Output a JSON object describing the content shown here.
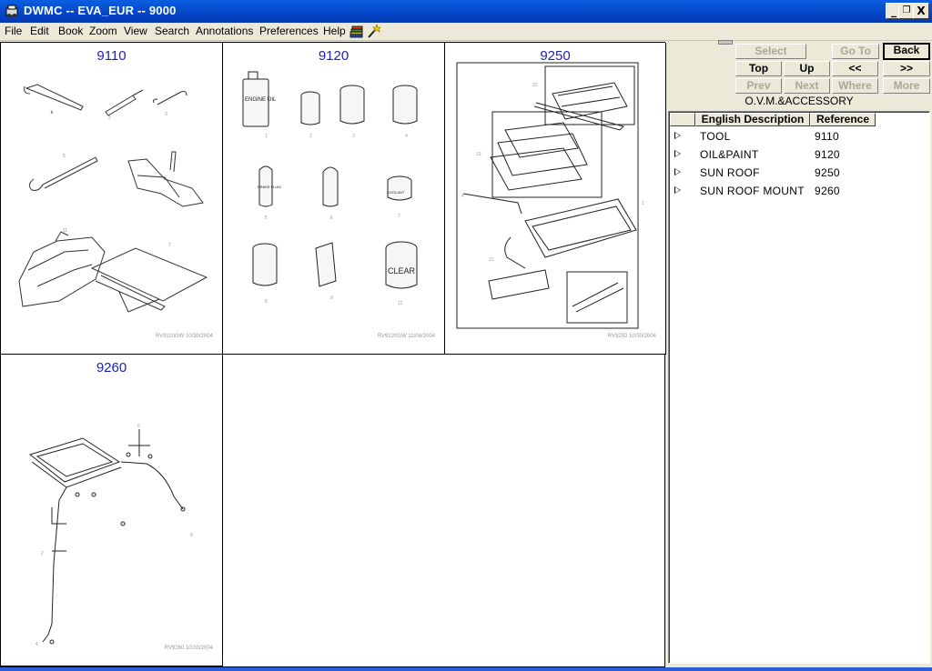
{
  "window": {
    "title": "DWMC -- EVA_EUR -- 9000",
    "minimize_label": "_",
    "restore_label": "❐",
    "close_label": "X"
  },
  "menu": [
    {
      "label": "File"
    },
    {
      "label": "Edit"
    },
    {
      "label": "Book"
    },
    {
      "label": "Zoom"
    },
    {
      "label": "View"
    },
    {
      "label": "Search"
    },
    {
      "label": "Annotations"
    },
    {
      "label": "Preferences"
    },
    {
      "label": "Help"
    }
  ],
  "toolbar_icons": [
    "book-stack-icon",
    "magic-wand-icon"
  ],
  "thumbnails": [
    {
      "ref": "9110",
      "footer": "RV9110GW  10/30/2004"
    },
    {
      "ref": "9120",
      "footer": "RV9120GW  11/08/2004"
    },
    {
      "ref": "9250",
      "footer": "RV9250  10/30/2004"
    },
    {
      "ref": "9260",
      "footer": "RV9260  10/30/2004"
    }
  ],
  "drawing_labels": {
    "engine_oil": "ENGINE OIL",
    "coolant": "COOLANT",
    "brake_fluid": "BRAKE FLUID",
    "clear": "CLEAR"
  },
  "nav": {
    "select": "Select",
    "goto": "Go To",
    "back": "Back",
    "top": "Top",
    "up": "Up",
    "prev_page": "<<",
    "next_page": ">>",
    "prev": "Prev",
    "next": "Next",
    "where": "Where",
    "more": "More"
  },
  "panel": {
    "heading": "O.V.M.&ACCESSORY",
    "col_description": "English Description",
    "col_reference": "Reference",
    "rows": [
      {
        "description": "TOOL",
        "reference": "9110"
      },
      {
        "description": "OIL&PAINT",
        "reference": "9120"
      },
      {
        "description": "SUN ROOF",
        "reference": "9250"
      },
      {
        "description": "SUN ROOF MOUNT",
        "reference": "9260"
      }
    ]
  },
  "colors": {
    "title_bar": "#0545c8",
    "thumb_title": "#1a24b8",
    "window_bg": "#ece9d8"
  }
}
